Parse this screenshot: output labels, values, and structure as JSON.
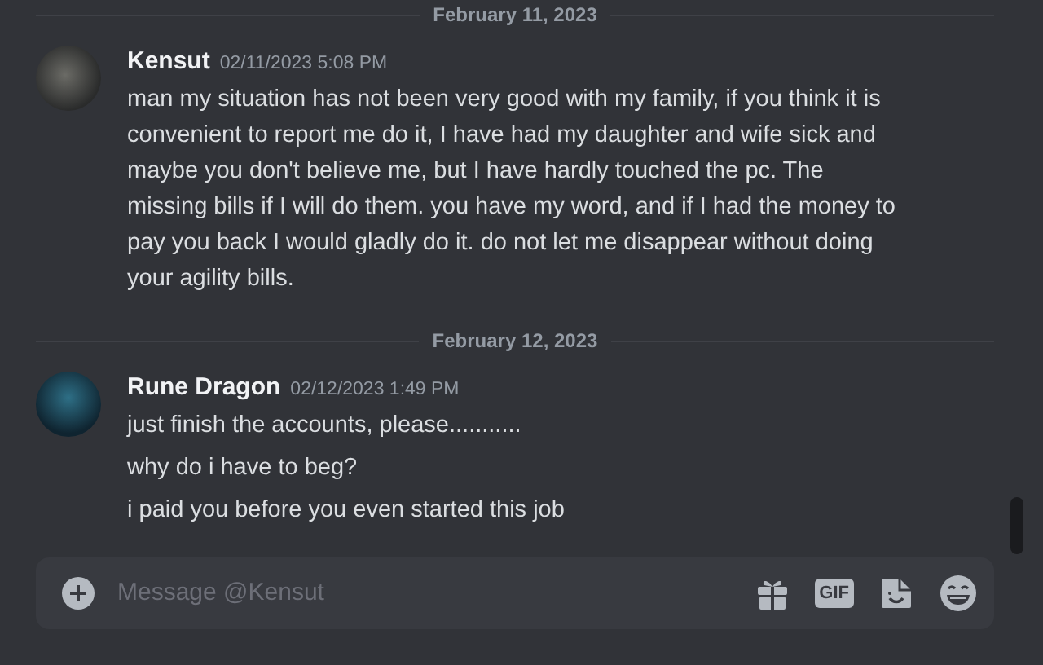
{
  "groups": [
    {
      "divider": "February 11, 2023",
      "author": "Kensut",
      "timestamp": "02/11/2023 5:08 PM",
      "kind": "photo",
      "messages": [
        "man my situation has not been very good with my family, if you think it is convenient to report me do it, I have had my daughter and wife sick and maybe you don't believe me, but I have hardly touched the pc. The missing bills if I will do them. you have my word, and if I had the money to pay you back I would gladly do it. do not let me disappear without doing your agility bills."
      ]
    },
    {
      "divider": "February 12, 2023",
      "author": "Rune Dragon",
      "timestamp": "02/12/2023 1:49 PM",
      "kind": "dragon",
      "messages": [
        "just finish the accounts, please...........",
        "why do i have to beg?",
        "i paid you before you even started this job"
      ]
    }
  ],
  "composer": {
    "placeholder": "Message @Kensut",
    "gif_label": "GIF"
  }
}
